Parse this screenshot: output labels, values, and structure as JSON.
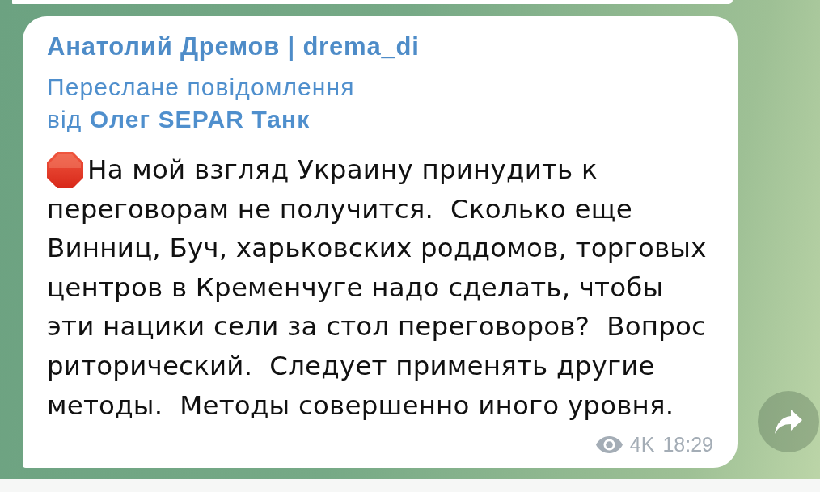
{
  "message": {
    "author": "Анатолий Дремов | drema_di",
    "forwarded": {
      "label": "Переслане повідомлення",
      "from": "від **Олег SEPAR Танк**"
    },
    "text": "На мой взгляд Украину принудить к\nпереговорам не получится.  Сколько еще\nВинниц, Буч, харьковских роддомов, торговых\nцентров в Кременчуге надо сделать, чтобы\nэти нацики сели за стол переговоров?  Вопрос\nриторический.  Следует применять другие\nметоды.  Методы совершенно иного уровня.",
    "views": "4K",
    "time": "18:29"
  }
}
